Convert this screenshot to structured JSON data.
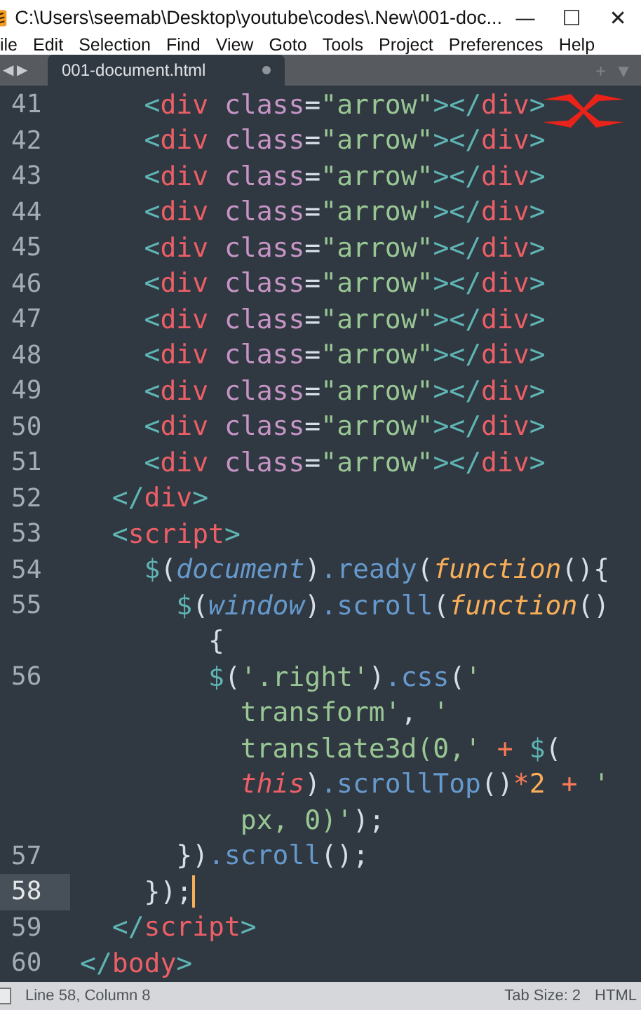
{
  "window": {
    "title": "C:\\Users\\seemab\\Desktop\\youtube\\codes\\.New\\001-doc...",
    "controls": [
      "—",
      "☐",
      "✕"
    ]
  },
  "menu": [
    "ile",
    "Edit",
    "Selection",
    "Find",
    "View",
    "Goto",
    "Tools",
    "Project",
    "Preferences",
    "Help"
  ],
  "tab_bar": {
    "nav": [
      "◀",
      "▶"
    ],
    "tabs": [
      {
        "label": "001-document.html",
        "selected": true,
        "modified": true
      }
    ],
    "actions": [
      "+",
      "▼"
    ]
  },
  "editor": {
    "rows": [
      {
        "number": "41",
        "selected": false,
        "tokens": [
          {
            "kind": "bracket",
            "text": "    <"
          },
          {
            "kind": "tag",
            "text": "div"
          },
          {
            "kind": "attr",
            "text": " class"
          },
          {
            "kind": "plain",
            "text": "="
          },
          {
            "kind": "string",
            "text": "\"arrow\""
          },
          {
            "kind": "bracket",
            "text": "></"
          },
          {
            "kind": "tag",
            "text": "div"
          },
          {
            "kind": "bracket",
            "text": ">"
          }
        ]
      },
      {
        "number": "42",
        "selected": false,
        "tokens": [
          {
            "kind": "bracket",
            "text": "    <"
          },
          {
            "kind": "tag",
            "text": "div"
          },
          {
            "kind": "attr",
            "text": " class"
          },
          {
            "kind": "plain",
            "text": "="
          },
          {
            "kind": "string",
            "text": "\"arrow\""
          },
          {
            "kind": "bracket",
            "text": "></"
          },
          {
            "kind": "tag",
            "text": "div"
          },
          {
            "kind": "bracket",
            "text": ">"
          }
        ]
      },
      {
        "number": "43",
        "selected": false,
        "tokens": [
          {
            "kind": "bracket",
            "text": "    <"
          },
          {
            "kind": "tag",
            "text": "div"
          },
          {
            "kind": "attr",
            "text": " class"
          },
          {
            "kind": "plain",
            "text": "="
          },
          {
            "kind": "string",
            "text": "\"arrow\""
          },
          {
            "kind": "bracket",
            "text": "></"
          },
          {
            "kind": "tag",
            "text": "div"
          },
          {
            "kind": "bracket",
            "text": ">"
          }
        ]
      },
      {
        "number": "44",
        "selected": false,
        "tokens": [
          {
            "kind": "bracket",
            "text": "    <"
          },
          {
            "kind": "tag",
            "text": "div"
          },
          {
            "kind": "attr",
            "text": " class"
          },
          {
            "kind": "plain",
            "text": "="
          },
          {
            "kind": "string",
            "text": "\"arrow\""
          },
          {
            "kind": "bracket",
            "text": "></"
          },
          {
            "kind": "tag",
            "text": "div"
          },
          {
            "kind": "bracket",
            "text": ">"
          }
        ]
      },
      {
        "number": "45",
        "selected": false,
        "tokens": [
          {
            "kind": "bracket",
            "text": "    <"
          },
          {
            "kind": "tag",
            "text": "div"
          },
          {
            "kind": "attr",
            "text": " class"
          },
          {
            "kind": "plain",
            "text": "="
          },
          {
            "kind": "string",
            "text": "\"arrow\""
          },
          {
            "kind": "bracket",
            "text": "></"
          },
          {
            "kind": "tag",
            "text": "div"
          },
          {
            "kind": "bracket",
            "text": ">"
          }
        ]
      },
      {
        "number": "46",
        "selected": false,
        "tokens": [
          {
            "kind": "bracket",
            "text": "    <"
          },
          {
            "kind": "tag",
            "text": "div"
          },
          {
            "kind": "attr",
            "text": " class"
          },
          {
            "kind": "plain",
            "text": "="
          },
          {
            "kind": "string",
            "text": "\"arrow\""
          },
          {
            "kind": "bracket",
            "text": "></"
          },
          {
            "kind": "tag",
            "text": "div"
          },
          {
            "kind": "bracket",
            "text": ">"
          }
        ]
      },
      {
        "number": "47",
        "selected": false,
        "tokens": [
          {
            "kind": "bracket",
            "text": "    <"
          },
          {
            "kind": "tag",
            "text": "div"
          },
          {
            "kind": "attr",
            "text": " class"
          },
          {
            "kind": "plain",
            "text": "="
          },
          {
            "kind": "string",
            "text": "\"arrow\""
          },
          {
            "kind": "bracket",
            "text": "></"
          },
          {
            "kind": "tag",
            "text": "div"
          },
          {
            "kind": "bracket",
            "text": ">"
          }
        ]
      },
      {
        "number": "48",
        "selected": false,
        "tokens": [
          {
            "kind": "bracket",
            "text": "    <"
          },
          {
            "kind": "tag",
            "text": "div"
          },
          {
            "kind": "attr",
            "text": " class"
          },
          {
            "kind": "plain",
            "text": "="
          },
          {
            "kind": "string",
            "text": "\"arrow\""
          },
          {
            "kind": "bracket",
            "text": "></"
          },
          {
            "kind": "tag",
            "text": "div"
          },
          {
            "kind": "bracket",
            "text": ">"
          }
        ]
      },
      {
        "number": "49",
        "selected": false,
        "tokens": [
          {
            "kind": "bracket",
            "text": "    <"
          },
          {
            "kind": "tag",
            "text": "div"
          },
          {
            "kind": "attr",
            "text": " class"
          },
          {
            "kind": "plain",
            "text": "="
          },
          {
            "kind": "string",
            "text": "\"arrow\""
          },
          {
            "kind": "bracket",
            "text": "></"
          },
          {
            "kind": "tag",
            "text": "div"
          },
          {
            "kind": "bracket",
            "text": ">"
          }
        ]
      },
      {
        "number": "50",
        "selected": false,
        "tokens": [
          {
            "kind": "bracket",
            "text": "    <"
          },
          {
            "kind": "tag",
            "text": "div"
          },
          {
            "kind": "attr",
            "text": " class"
          },
          {
            "kind": "plain",
            "text": "="
          },
          {
            "kind": "string",
            "text": "\"arrow\""
          },
          {
            "kind": "bracket",
            "text": "></"
          },
          {
            "kind": "tag",
            "text": "div"
          },
          {
            "kind": "bracket",
            "text": ">"
          }
        ]
      },
      {
        "number": "51",
        "selected": false,
        "tokens": [
          {
            "kind": "bracket",
            "text": "    <"
          },
          {
            "kind": "tag",
            "text": "div"
          },
          {
            "kind": "attr",
            "text": " class"
          },
          {
            "kind": "plain",
            "text": "="
          },
          {
            "kind": "string",
            "text": "\"arrow\""
          },
          {
            "kind": "bracket",
            "text": "></"
          },
          {
            "kind": "tag",
            "text": "div"
          },
          {
            "kind": "bracket",
            "text": ">"
          }
        ]
      },
      {
        "number": "52",
        "selected": false,
        "tokens": [
          {
            "kind": "bracket",
            "text": "  </"
          },
          {
            "kind": "tag",
            "text": "div"
          },
          {
            "kind": "bracket",
            "text": ">"
          }
        ]
      },
      {
        "number": "53",
        "selected": false,
        "tokens": [
          {
            "kind": "bracket",
            "text": "  <"
          },
          {
            "kind": "tag",
            "text": "script"
          },
          {
            "kind": "bracket",
            "text": ">"
          }
        ]
      },
      {
        "number": "54",
        "selected": false,
        "tokens": [
          {
            "kind": "dollar",
            "text": "    $"
          },
          {
            "kind": "plain",
            "text": "("
          },
          {
            "kind": "var",
            "text": "document"
          },
          {
            "kind": "plain",
            "text": ")"
          },
          {
            "kind": "method",
            "text": ".ready"
          },
          {
            "kind": "plain",
            "text": "("
          },
          {
            "kind": "keyword",
            "text": "function"
          },
          {
            "kind": "plain",
            "text": "(){"
          }
        ]
      },
      {
        "number": "55",
        "selected": false,
        "tokens": [
          {
            "kind": "dollar",
            "text": "      $"
          },
          {
            "kind": "plain",
            "text": "("
          },
          {
            "kind": "var",
            "text": "window"
          },
          {
            "kind": "plain",
            "text": ")"
          },
          {
            "kind": "method",
            "text": ".scroll"
          },
          {
            "kind": "plain",
            "text": "("
          },
          {
            "kind": "keyword",
            "text": "function"
          },
          {
            "kind": "plain",
            "text": "()"
          }
        ]
      },
      {
        "selected": false,
        "tokens": [
          {
            "kind": "plain",
            "text": "        {"
          }
        ]
      },
      {
        "number": "56",
        "selected": false,
        "tokens": [
          {
            "kind": "dollar",
            "text": "        $"
          },
          {
            "kind": "plain",
            "text": "("
          },
          {
            "kind": "string",
            "text": "'.right'"
          },
          {
            "kind": "plain",
            "text": ")"
          },
          {
            "kind": "method",
            "text": ".css"
          },
          {
            "kind": "plain",
            "text": "("
          },
          {
            "kind": "string",
            "text": "'"
          }
        ]
      },
      {
        "selected": false,
        "tokens": [
          {
            "kind": "string",
            "text": "          transform'"
          },
          {
            "kind": "plain",
            "text": ","
          },
          {
            "kind": "string",
            "text": " '"
          }
        ]
      },
      {
        "selected": false,
        "tokens": [
          {
            "kind": "string",
            "text": "          translate3d(0,'"
          },
          {
            "kind": "op",
            "text": " + "
          },
          {
            "kind": "dollar",
            "text": "$"
          },
          {
            "kind": "plain",
            "text": "("
          }
        ]
      },
      {
        "selected": false,
        "tokens": [
          {
            "kind": "this",
            "text": "          this"
          },
          {
            "kind": "plain",
            "text": ")"
          },
          {
            "kind": "method",
            "text": ".scrollTop"
          },
          {
            "kind": "plain",
            "text": "()"
          },
          {
            "kind": "op",
            "text": "*"
          },
          {
            "kind": "number",
            "text": "2"
          },
          {
            "kind": "op",
            "text": " + "
          },
          {
            "kind": "string",
            "text": "'"
          }
        ]
      },
      {
        "selected": false,
        "tokens": [
          {
            "kind": "string",
            "text": "          px, 0)'"
          },
          {
            "kind": "plain",
            "text": ");"
          }
        ]
      },
      {
        "number": "57",
        "selected": false,
        "tokens": [
          {
            "kind": "plain",
            "text": "      })"
          },
          {
            "kind": "method",
            "text": ".scroll"
          },
          {
            "kind": "plain",
            "text": "();"
          }
        ]
      },
      {
        "number": "58",
        "selected": true,
        "cursor": true,
        "tokens": [
          {
            "kind": "plain",
            "text": "    });"
          }
        ]
      },
      {
        "number": "59",
        "selected": false,
        "tokens": [
          {
            "kind": "bracket",
            "text": "  </"
          },
          {
            "kind": "tag",
            "text": "script"
          },
          {
            "kind": "bracket",
            "text": ">"
          }
        ]
      },
      {
        "number": "60",
        "selected": false,
        "tokens": [
          {
            "kind": "bracket",
            "text": "</"
          },
          {
            "kind": "tag",
            "text": "body"
          },
          {
            "kind": "bracket",
            "text": ">"
          }
        ]
      }
    ]
  },
  "status_bar": {
    "position": "Line 58, Column 8",
    "tab_size": "Tab Size: 2",
    "syntax": "HTML"
  }
}
